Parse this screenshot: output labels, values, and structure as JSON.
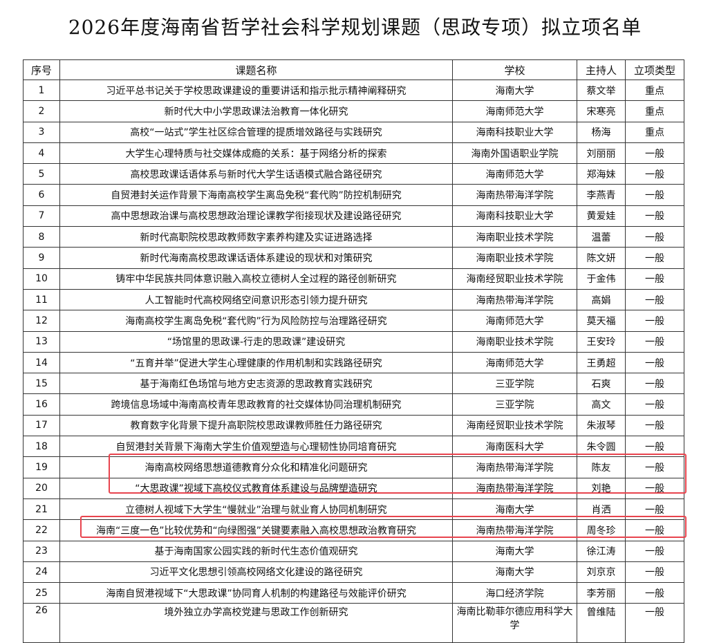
{
  "title": "2026年度海南省哲学社会科学规划课题（思政专项）拟立项名单",
  "headers": [
    "序号",
    "课题名称",
    "学校",
    "主持人",
    "立项类型"
  ],
  "rows": [
    [
      "1",
      "习近平总书记关于学校思政课建设的重要讲话和指示批示精神阐释研究",
      "海南大学",
      "蔡文举",
      "重点"
    ],
    [
      "2",
      "新时代大中小学思政课法治教育一体化研究",
      "海南师范大学",
      "宋寒亮",
      "重点"
    ],
    [
      "3",
      "高校“一站式”学生社区综合管理的提质增效路径与实践研究",
      "海南科技职业大学",
      "杨海",
      "重点"
    ],
    [
      "4",
      "大学生心理特质与社交媒体成瘾的关系：基于网络分析的探索",
      "海南外国语职业学院",
      "刘丽丽",
      "一般"
    ],
    [
      "5",
      "高校思政课话语体系与新时代大学生话语模式融合路径研究",
      "海南师范大学",
      "郑海妹",
      "一般"
    ],
    [
      "6",
      "自贸港封关运作背景下海南高校学生离岛免税“套代购”防控机制研究",
      "海南热带海洋学院",
      "李燕青",
      "一般"
    ],
    [
      "7",
      "高中思想政治课与高校思想政治理论课教学衔接现状及建设路径研究",
      "海南科技职业大学",
      "黄爱娃",
      "一般"
    ],
    [
      "8",
      "新时代高职院校思政教师数字素养构建及实证进路选择",
      "海南职业技术学院",
      "温蕾",
      "一般"
    ],
    [
      "9",
      "新时代海南高校思政课话语体系建设的现状和对策研究",
      "海南职业技术学院",
      "陈文妍",
      "一般"
    ],
    [
      "10",
      "铸牢中华民族共同体意识融入高校立德树人全过程的路径创新研究",
      "海南经贸职业技术学院",
      "于金伟",
      "一般"
    ],
    [
      "11",
      "人工智能时代高校网络空间意识形态引领力提升研究",
      "海南热带海洋学院",
      "高娟",
      "一般"
    ],
    [
      "12",
      "海南高校学生离岛免税“套代购”行为风险防控与治理路径研究",
      "海南师范大学",
      "莫天福",
      "一般"
    ],
    [
      "13",
      "“场馆里的思政课-行走的思政课”建设研究",
      "海南职业技术学院",
      "王安玲",
      "一般"
    ],
    [
      "14",
      "“五育并举”促进大学生心理健康的作用机制和实践路径研究",
      "海南师范大学",
      "王勇超",
      "一般"
    ],
    [
      "15",
      "基于海南红色场馆与地方史志资源的思政教育实践研究",
      "三亚学院",
      "石爽",
      "一般"
    ],
    [
      "16",
      "跨境信息场域中海南高校青年思政教育的社交媒体协同治理机制研究",
      "三亚学院",
      "高文",
      "一般"
    ],
    [
      "17",
      "教育数字化背景下提升高职院校思政课教师胜任力路径研究",
      "海南经贸职业技术学院",
      "朱淑琴",
      "一般"
    ],
    [
      "18",
      "自贸港封关背景下海南大学生价值观塑造与心理韧性协同培育研究",
      "海南医科大学",
      "朱令圆",
      "一般"
    ],
    [
      "19",
      "海南高校网络思想道德教育分众化和精准化问题研究",
      "海南热带海洋学院",
      "陈友",
      "一般"
    ],
    [
      "20",
      "“大思政课”视域下高校仪式教育体系建设与品牌塑造研究",
      "海南热带海洋学院",
      "刘艳",
      "一般"
    ],
    [
      "21",
      "立德树人视域下大学生“慢就业”治理与就业育人协同机制研究",
      "海南大学",
      "肖洒",
      "一般"
    ],
    [
      "22",
      "海南“三度一色”比较优势和“向绿图强”关键要素融入高校思想政治教育研究",
      "海南热带海洋学院",
      "周冬珍",
      "一般"
    ],
    [
      "23",
      "基于海南国家公园实践的新时代生态价值观研究",
      "海南大学",
      "徐江涛",
      "一般"
    ],
    [
      "24",
      "习近平文化思想引领高校网络文化建设的路径研究",
      "海南大学",
      "刘京京",
      "一般"
    ],
    [
      "25",
      "海南自贸港视域下“大思政课”协同育人机制的构建路径与效能评价研究",
      "海口经济学院",
      "李芳丽",
      "一般"
    ],
    [
      "26",
      "境外独立办学高校党建与思政工作创新研究",
      "海南比勒菲尔德应用科学大学",
      "曾维陆",
      "一般"
    ]
  ],
  "highlight_color": "#e8434d"
}
